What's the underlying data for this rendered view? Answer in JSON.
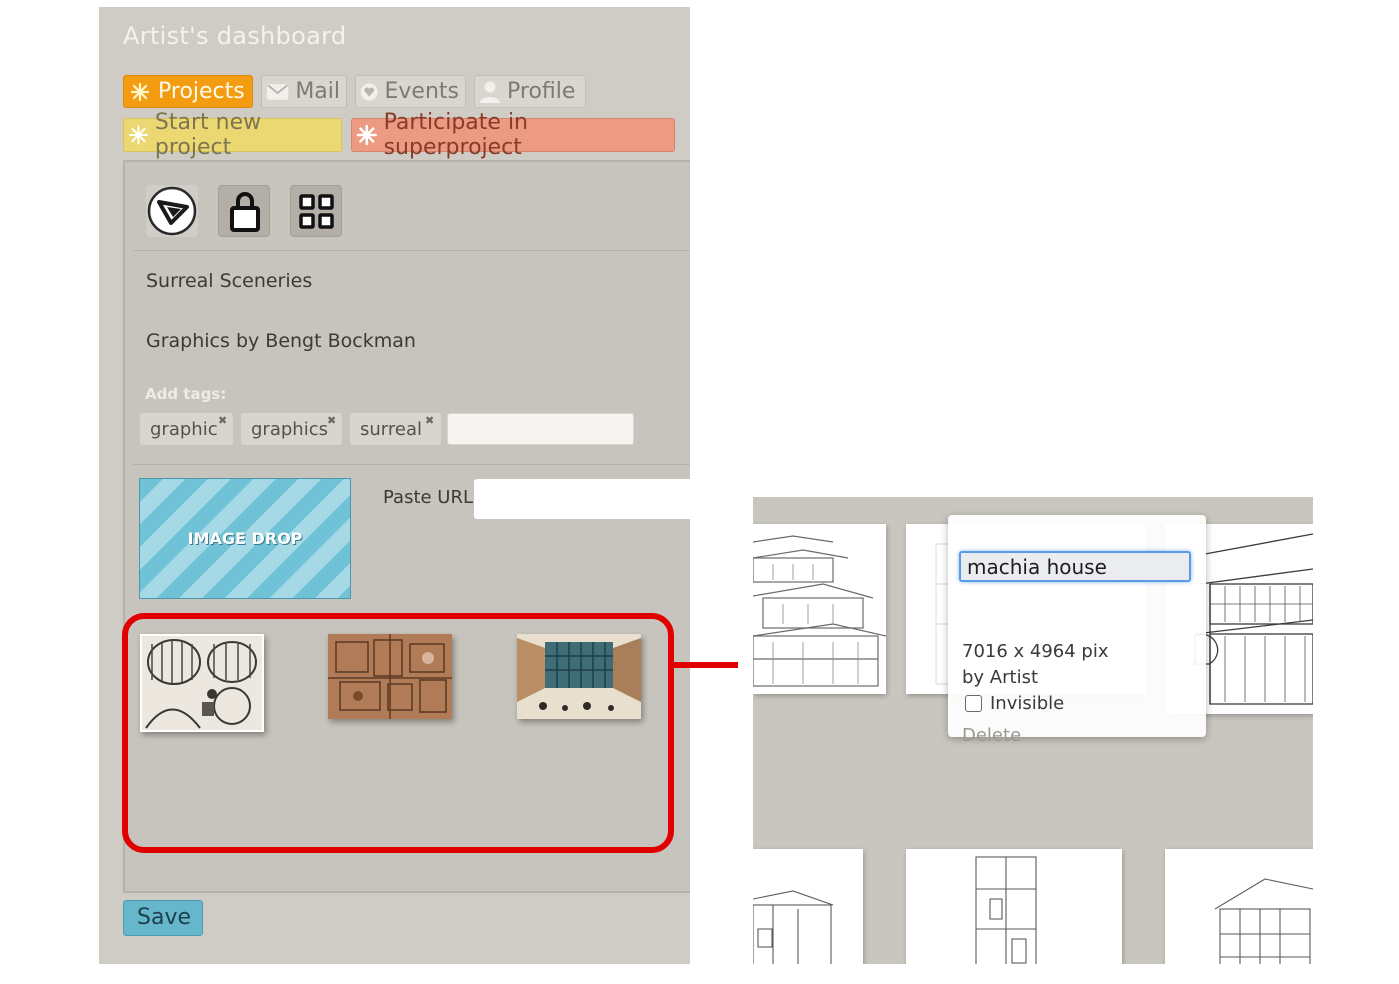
{
  "dashboard": {
    "title": "Artist's dashboard",
    "tabs": [
      {
        "label": "Projects",
        "icon": "sparkle-icon",
        "active": true
      },
      {
        "label": "Mail",
        "icon": "envelope-icon",
        "active": false
      },
      {
        "label": "Events",
        "icon": "heart-badge-icon",
        "active": false
      },
      {
        "label": "Profile",
        "icon": "person-icon",
        "active": false
      }
    ],
    "actions": {
      "start_new": "Start new project",
      "participate": "Participate in superproject"
    },
    "toolbar": [
      "play-icon",
      "lock-icon",
      "grid-icon"
    ],
    "project": {
      "title": "Surreal Sceneries",
      "description": "Graphics by Bengt Bockman",
      "add_tags_label": "Add tags:",
      "tags": [
        "graphic",
        "graphics",
        "surreal"
      ],
      "tag_input_value": ""
    },
    "image_drop_label": "IMAGE DROP",
    "paste_url_label": "Paste URL",
    "paste_url_value": "",
    "save_label": "Save"
  },
  "zoom": {
    "image_title": "machia house",
    "dimensions": "7016 x 4964 pix",
    "by": "by Artist",
    "invisible_label": "Invisible",
    "invisible_checked": false,
    "delete_label": "Delete"
  },
  "colors": {
    "panel_bg": "#cfccc5",
    "active_tab": "#f39c12",
    "start_new_bg": "#ecd873",
    "participate_bg": "#ec9a82",
    "save_bg": "#66b6cc",
    "highlight": "#e10000"
  }
}
